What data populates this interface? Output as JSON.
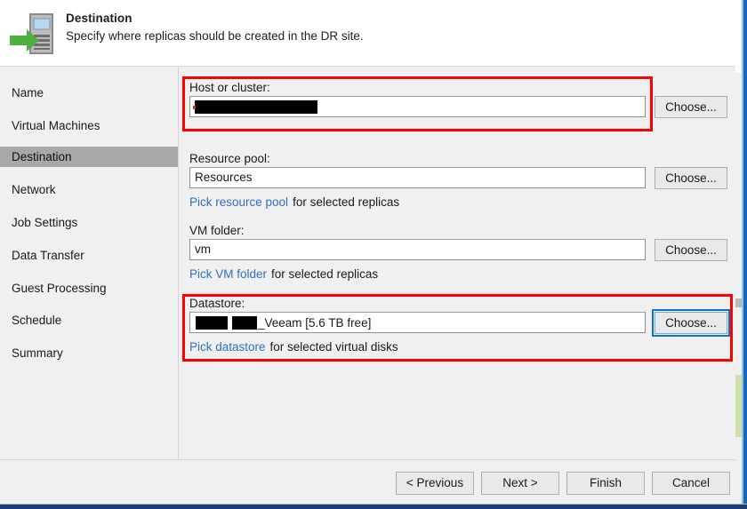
{
  "header": {
    "title": "Destination",
    "subtitle": "Specify where replicas should be created in the DR site.",
    "icon": "server-replica-arrow-icon"
  },
  "sidebar": {
    "items": [
      {
        "label": "Name",
        "selected": false
      },
      {
        "label": "Virtual Machines",
        "selected": false
      },
      {
        "label": "Destination",
        "selected": true
      },
      {
        "label": "Network",
        "selected": false
      },
      {
        "label": "Job Settings",
        "selected": false
      },
      {
        "label": "Data Transfer",
        "selected": false
      },
      {
        "label": "Guest Processing",
        "selected": false
      },
      {
        "label": "Schedule",
        "selected": false
      },
      {
        "label": "Summary",
        "selected": false
      }
    ]
  },
  "main": {
    "host": {
      "label": "Host or cluster:",
      "value": "",
      "redacted": true,
      "choose_label": "Choose...",
      "highlighted": true
    },
    "resource_pool": {
      "label": "Resource pool:",
      "value": "Resources",
      "choose_label": "Choose...",
      "hint_link": "Pick resource pool",
      "hint_rest": "for selected replicas"
    },
    "vm_folder": {
      "label": "VM folder:",
      "value": "vm",
      "choose_label": "Choose...",
      "hint_link": "Pick VM folder",
      "hint_rest": "for selected replicas"
    },
    "datastore": {
      "label": "Datastore:",
      "value_suffix": "_Veeam [5.6 TB free]",
      "redacted": true,
      "choose_label": "Choose...",
      "choose_focused": true,
      "hint_link": "Pick datastore",
      "hint_rest": "for selected virtual disks",
      "highlighted": true
    }
  },
  "footer": {
    "previous_label": "< Previous",
    "next_label": "Next >",
    "finish_label": "Finish",
    "cancel_label": "Cancel"
  },
  "colors": {
    "highlight_red": "#ff0000",
    "link_blue": "#2f6fc0",
    "focus_blue": "#0a72d6",
    "selection_gray": "#a8a8a8",
    "window_border_blue": "#1b66b5",
    "icon_green": "#4caf3f"
  }
}
